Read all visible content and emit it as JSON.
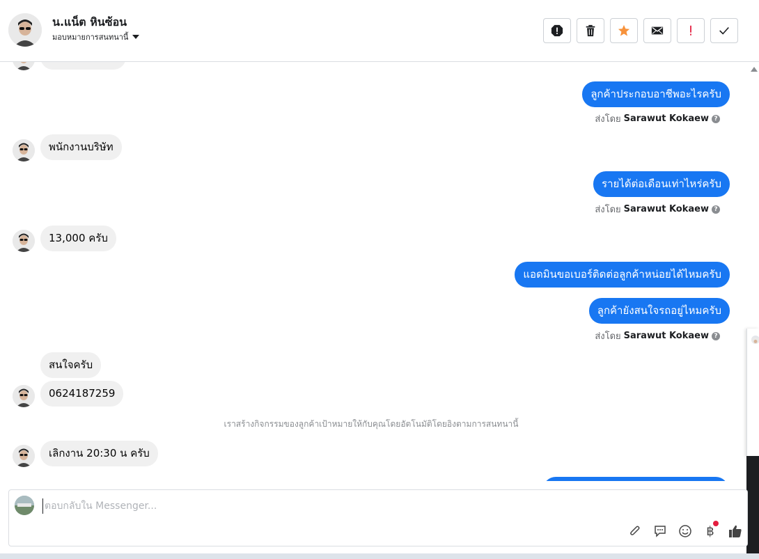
{
  "header": {
    "contact_name": "น.แน็ต หินซ้อน",
    "assign_label": "มอบหมายการสนทนานี้",
    "actions": [
      {
        "name": "mark-spam-button",
        "icon": "alert-octagon-icon"
      },
      {
        "name": "delete-button",
        "icon": "trash-icon"
      },
      {
        "name": "star-button",
        "icon": "star-icon"
      },
      {
        "name": "mark-unread-button",
        "icon": "envelope-icon"
      },
      {
        "name": "follow-up-button",
        "icon": "exclamation-icon"
      },
      {
        "name": "mark-done-button",
        "icon": "check-icon"
      }
    ],
    "star_color": "#f7923b",
    "flag_color": "#e41e3f"
  },
  "messages": {
    "out_1": "ลูกค้าประกอบอาชีพอะไรครับ",
    "in_1": "พนักงานบริษัท",
    "out_2": "รายได้ต่อเดือนเท่าไหร่ครับ",
    "in_2": "13,000 ครับ",
    "out_3": "แอดมินขอเบอร์ติดต่อลูกค้าหน่อยได้ไหมครับ",
    "out_4": "ลูกค้ายังสนใจรถอยู่ไหมครับ",
    "in_3": "สนใจครับ",
    "in_4": "0624187259",
    "system_note": "เราสร้างกิจกรรมของลูกค้าเป้าหมายให้กับคุณโดยอัตโนมัติโดยอิงตามการสนทนานี้",
    "in_5": "เลิกงาน 20:30 น ครับ"
  },
  "sent_by": {
    "prefix": "ส่งโดย",
    "name": "Sarawut Kokaew",
    "help": "?"
  },
  "composer": {
    "placeholder": "ตอบกลับใน Messenger...",
    "currency_symbol": "฿",
    "accent_color": "#1877f2"
  }
}
